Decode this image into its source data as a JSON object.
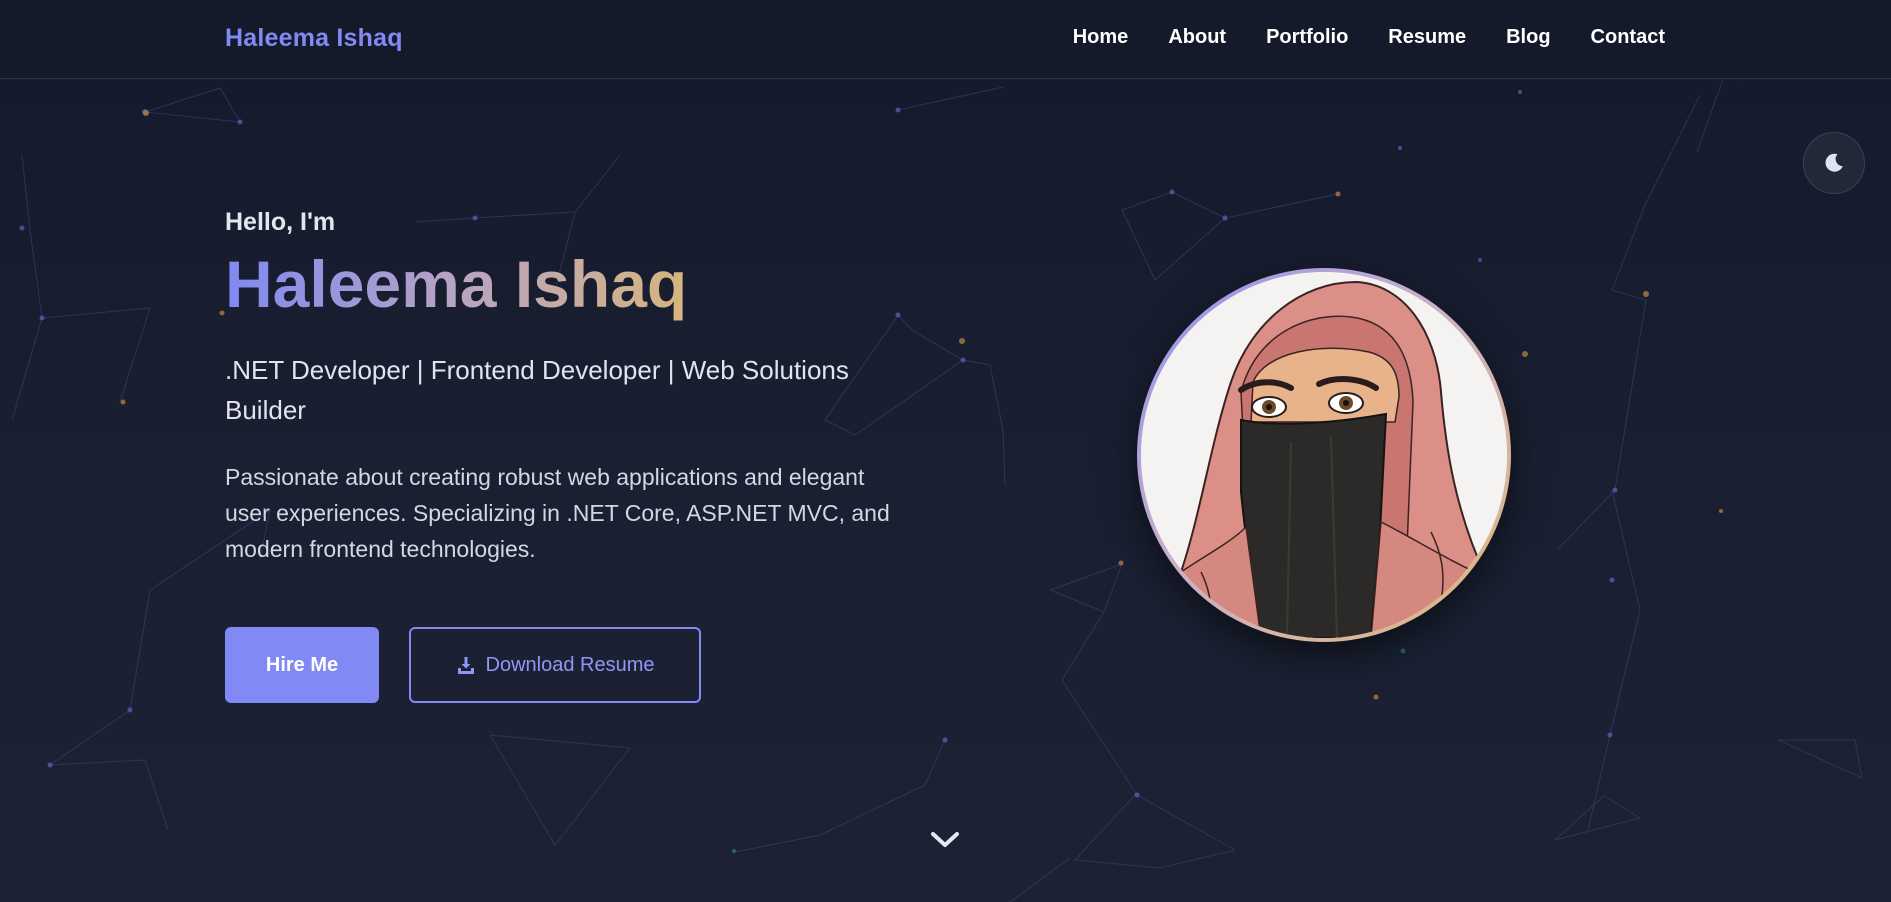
{
  "nav": {
    "brand": "Haleema Ishaq",
    "links": [
      "Home",
      "About",
      "Portfolio",
      "Resume",
      "Blog",
      "Contact"
    ]
  },
  "theme_toggle": {
    "icon": "moon-icon"
  },
  "hero": {
    "greeting": "Hello, I'm",
    "name": "Haleema Ishaq",
    "roles": ".NET Developer | Frontend Developer | Web Solutions Builder",
    "description": "Passionate about creating robust web applications and elegant user experiences. Specializing in .NET Core, ASP.NET MVC, and modern frontend technologies.",
    "hire_button": "Hire Me",
    "resume_button": "Download Resume",
    "resume_icon": "download-icon"
  },
  "avatar": {
    "description_icon": "avatar-illustration"
  },
  "scroll": {
    "icon": "chevron-down-icon"
  },
  "colors": {
    "accent": "#8189f5",
    "gold": "#d8b47e",
    "background": "#1a2032",
    "navbar": "#141a2a"
  }
}
